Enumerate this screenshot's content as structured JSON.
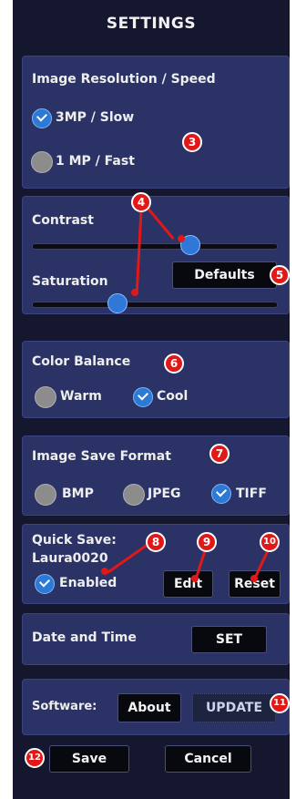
{
  "title": "SETTINGS",
  "resolution": {
    "title": "Image Resolution / Speed",
    "opt1": "3MP / Slow",
    "opt2": "1 MP / Fast"
  },
  "contrast": {
    "contrast_label": "Contrast",
    "saturation_label": "Saturation",
    "defaults_label": "Defaults",
    "contrast_level": 0.65,
    "saturation_level": 0.35
  },
  "color_balance": {
    "title": "Color Balance",
    "warm": "Warm",
    "cool": "Cool"
  },
  "save_format": {
    "title": "Image Save Format",
    "bmp": "BMP",
    "jpeg": "JPEG",
    "tiff": "TIFF"
  },
  "quick_save": {
    "title": "Quick Save:",
    "filename": "Laura0020",
    "enabled": "Enabled",
    "edit": "Edit",
    "reset": "Reset"
  },
  "date_time": {
    "label": "Date and Time",
    "set": "SET"
  },
  "software": {
    "label": "Software:",
    "about": "About",
    "update": "UPDATE"
  },
  "footer": {
    "save": "Save",
    "cancel": "Cancel"
  },
  "callouts": [
    "3",
    "4",
    "5",
    "6",
    "7",
    "8",
    "9",
    "10",
    "11",
    "12"
  ],
  "colors": {
    "background": "#15172e",
    "panel": "#2b3266",
    "accent": "#2c7ad6",
    "callout": "#e11818"
  }
}
